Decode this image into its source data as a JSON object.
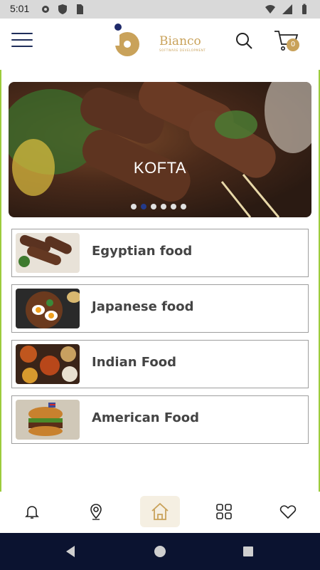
{
  "status": {
    "time": "5:01",
    "icons": [
      "settings-icon",
      "shield-icon",
      "sim-card-icon",
      "wifi-icon",
      "signal-icon",
      "battery-icon"
    ]
  },
  "header": {
    "brand_name": "Bianco",
    "brand_tagline": "SOFTWARE DEVELOPMENT",
    "cart_count": "0",
    "accent_color": "#c9a25a",
    "menu_color": "#1f2e5a"
  },
  "banner": {
    "caption": "KOFTA",
    "slide_count": 6,
    "active_slide": 2
  },
  "categories": [
    {
      "label": "Egyptian food",
      "image": "kofta-skewers"
    },
    {
      "label": "Japanese food",
      "image": "ramen-bowl"
    },
    {
      "label": "Indian Food",
      "image": "curry-dishes"
    },
    {
      "label": "American Food",
      "image": "burger"
    }
  ],
  "bottom_nav": {
    "items": [
      "notifications",
      "location",
      "home",
      "categories",
      "favorites"
    ],
    "active": "home"
  }
}
